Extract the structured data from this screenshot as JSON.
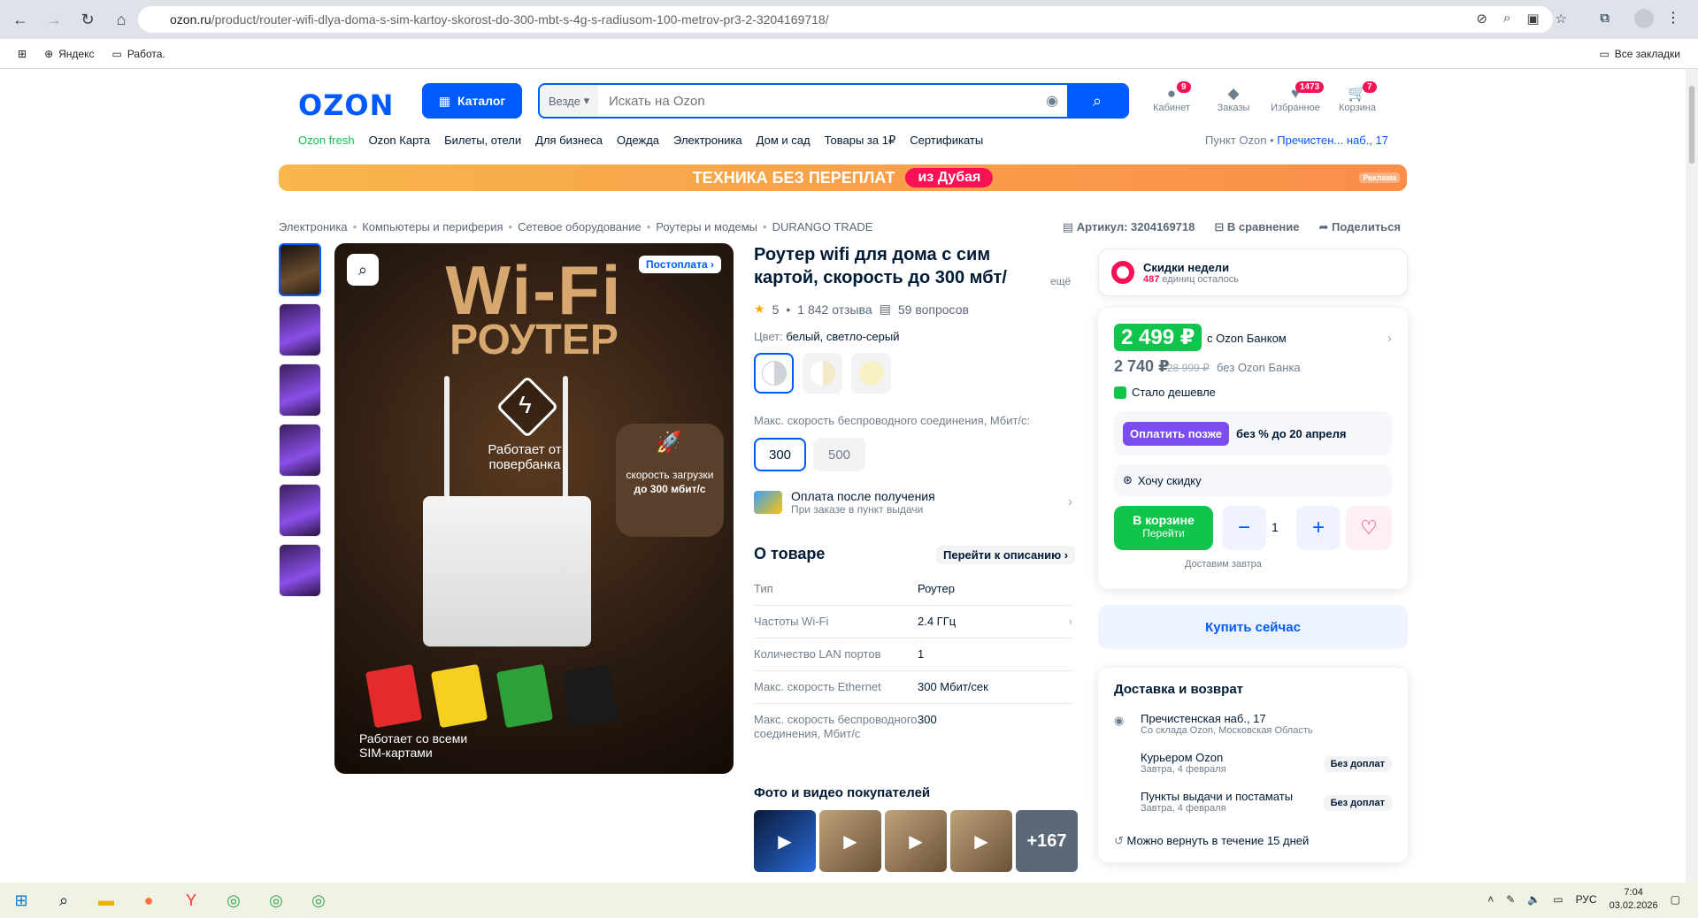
{
  "browser": {
    "url_host": "ozon.ru",
    "url_path": "/product/router-wifi-dlya-doma-s-sim-kartoy-skorost-do-300-mbt-s-4g-s-radiusom-100-metrov-pr3-2-3204169718/",
    "bookmarks": [
      "Яндекс",
      "Работа."
    ],
    "all_bookmarks": "Все закладки"
  },
  "header": {
    "logo": "OZON",
    "catalog": "Каталог",
    "search_scope": "Везде",
    "search_placeholder": "Искать на Ozon",
    "icons": [
      {
        "label": "Кабинет",
        "badge": "9"
      },
      {
        "label": "Заказы",
        "badge": ""
      },
      {
        "label": "Избранное",
        "badge": "1473"
      },
      {
        "label": "Корзина",
        "badge": "7"
      }
    ],
    "menu": [
      "Ozon fresh",
      "Ozon Карта",
      "Билеты, отели",
      "Для бизнеса",
      "Одежда",
      "Электроника",
      "Дом и сад",
      "Товары за 1₽",
      "Сертификаты"
    ],
    "pickup_label": "Пункт Ozon •",
    "pickup_value": "Пречистен... наб., 17"
  },
  "banner": {
    "text": "ТЕХНИКА БЕЗ ПЕРЕПЛАТ",
    "pill": "из Дубая",
    "ad": "Реклама"
  },
  "breadcrumbs": [
    "Электроника",
    "Компьютеры и периферия",
    "Сетевое оборудование",
    "Роутеры и модемы",
    "DURANGO TRADE"
  ],
  "meta": {
    "article": "Артикул: 3204169718",
    "compare": "В сравнение",
    "share": "Поделиться"
  },
  "gallery": {
    "title1": "Wi-Fi",
    "title2": "РОУТЕР",
    "power_text": "Работает от повербанка",
    "speed_text": "скорость загрузки",
    "speed_value": "до 300 мбит/с",
    "sim_text": "Работает со всеми SIM-картами",
    "postpay": "Постоплата"
  },
  "product": {
    "title": "Роутер wifi для дома с сим картой, скорость до 300 мбт/",
    "more": "ещё",
    "rating": "5",
    "reviews": "1 842 отзыва",
    "questions": "59 вопросов",
    "color_label": "Цвет:",
    "color_value": "белый, светло-серый",
    "speed_label": "Макс. скорость беспроводного соединения, Мбит/с:",
    "speed_options": [
      "300",
      "500"
    ],
    "pay_after_title": "Оплата после получения",
    "pay_after_sub": "При заказе в пункт выдачи",
    "about": "О товаре",
    "goto_desc": "Перейти к описанию",
    "specs": [
      {
        "k": "Тип",
        "v": "Роутер"
      },
      {
        "k": "Частоты Wi-Fi",
        "v": "2.4 ГГц"
      },
      {
        "k": "Количество LAN портов",
        "v": "1"
      },
      {
        "k": "Макс. скорость Ethernet",
        "v": "300 Мбит/сек"
      },
      {
        "k": "Макс. скорость беспроводного соединения, Мбит/с",
        "v": "300"
      }
    ],
    "photos_title": "Фото и видео покупателей",
    "photos_more": "+167"
  },
  "buybox": {
    "deals_title": "Скидки недели",
    "deals_count": "487",
    "deals_sub": "единиц осталось",
    "price_card": "2 499 ₽",
    "with_bank": "с Ozon Банком",
    "price_regular": "2 740 ₽",
    "price_old": "28 999 ₽",
    "without_bank": "без Ozon Банка",
    "cheaper": "Стало дешевле",
    "pay_later_btn": "Оплатить позже",
    "pay_later_text": "без % до 20 апреля",
    "want_discount": "Хочу скидку",
    "in_cart": "В корзине",
    "go": "Перейти",
    "qty": "1",
    "deliver": "Доставим завтра",
    "buy_now": "Купить сейчас"
  },
  "delivery": {
    "title": "Доставка и возврат",
    "rows": [
      {
        "title": "Пречистенская наб., 17",
        "sub": "Со склада Ozon, Московская Область",
        "tag": ""
      },
      {
        "title": "Курьером Ozon",
        "sub": "Завтра, 4 февраля",
        "tag": "Без доплат"
      },
      {
        "title": "Пункты выдачи и постаматы",
        "sub": "Завтра, 4 февраля",
        "tag": "Без доплат"
      }
    ],
    "return": "Можно вернуть в течение 15 дней"
  },
  "taskbar": {
    "lang": "РУС",
    "time": "7:04",
    "date": "03.02.2026"
  },
  "colors": {
    "accent": "#005bff",
    "green": "#10c44c",
    "pink": "#f91155"
  }
}
